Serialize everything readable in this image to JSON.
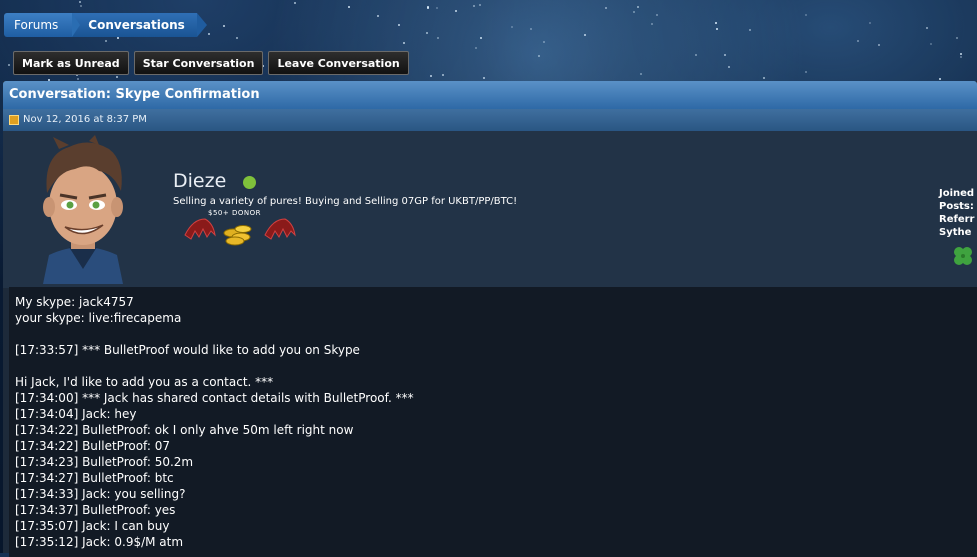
{
  "breadcrumb": {
    "forums_label": "Forums",
    "conversations_label": "Conversations"
  },
  "actions": {
    "mark_unread": "Mark as Unread",
    "star": "Star Conversation",
    "leave": "Leave Conversation"
  },
  "conversation": {
    "title": "Conversation: Skype Confirmation",
    "date": "Nov 12, 2016 at 8:37 PM"
  },
  "user": {
    "name": "Dieze",
    "status_color": "#7fc13b",
    "title_text": "Selling a variety of pures! Buying and Selling 07GP for UKBT/PP/BTC!",
    "badge_label": "$50+  DONOR",
    "stats": [
      "Joined",
      "Posts:",
      "Referr",
      "Sythe"
    ]
  },
  "message_lines": [
    "My skype: jack4757",
    "your skype: live:firecapema",
    "",
    "[17:33:57] *** BulletProof would like to add you on Skype",
    "",
    "Hi Jack, I'd like to add you as a contact. ***",
    "[17:34:00] *** Jack has shared contact details with BulletProof. ***",
    "[17:34:04] Jack: hey",
    "[17:34:22] BulletProof: ok I only ahve 50m left right now",
    "[17:34:22] BulletProof: 07",
    "[17:34:23] BulletProof: 50.2m",
    "[17:34:27] BulletProof: btc",
    "[17:34:33] Jack: you selling?",
    "[17:34:37] BulletProof: yes",
    "[17:35:07] Jack: I can buy",
    "[17:35:12] Jack: 0.9$/M atm"
  ]
}
